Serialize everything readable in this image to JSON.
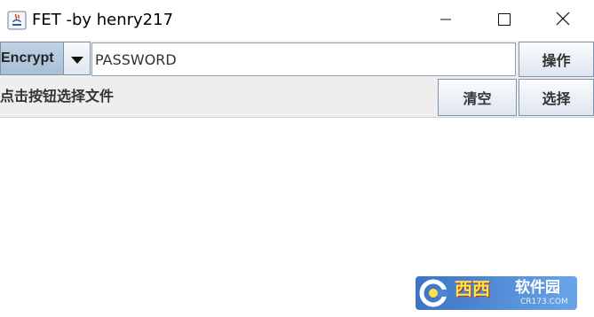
{
  "window": {
    "title": "FET -by henry217",
    "controls": {
      "minimize_icon": "minimize-icon",
      "maximize_icon": "maximize-icon",
      "close_icon": "close-icon"
    }
  },
  "toolbar": {
    "mode_selected": "Encrypt",
    "password_value": "PASSWORD",
    "operate_label": "操作"
  },
  "file_bar": {
    "hint": "点击按钮选择文件",
    "clear_label": "清空",
    "choose_label": "选择"
  },
  "watermark": {
    "brand": "西西",
    "brand_suffix": "软件园",
    "site": "CR173.COM"
  },
  "colors": {
    "select_accent": "#a9bfd6",
    "button_border": "#7f94ab",
    "panel_bg": "#eeeeee",
    "watermark_blue": "#3a74c4",
    "watermark_yellow": "#ffe24a"
  }
}
